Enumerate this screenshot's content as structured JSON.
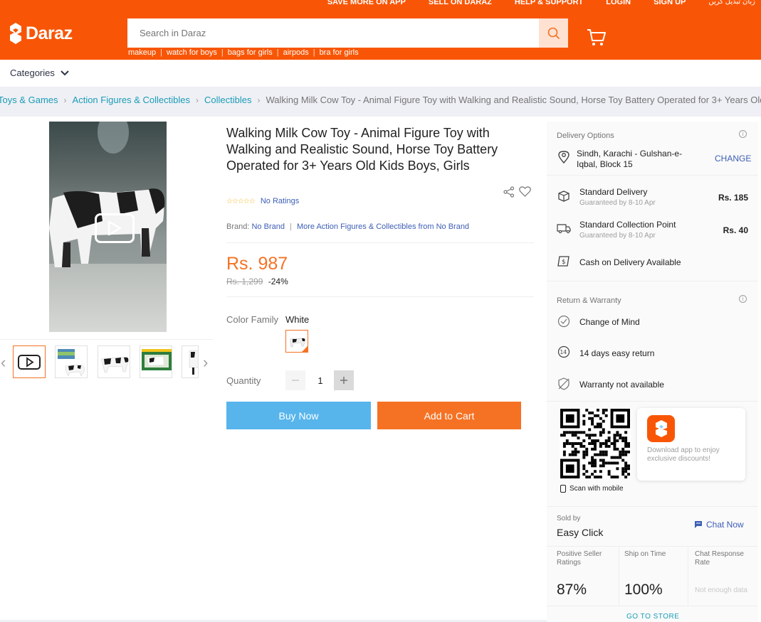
{
  "header": {
    "topnav": [
      "SAVE MORE ON APP",
      "SELL ON DARAZ",
      "HELP & SUPPORT",
      "LOGIN",
      "SIGN UP"
    ],
    "language": "زبان تبدیل کریں",
    "logo_text": "Daraz",
    "search_placeholder": "Search in Daraz",
    "suggestions": [
      "makeup",
      "watch for boys",
      "bags for girls",
      "airpods",
      "bra for girls"
    ]
  },
  "categories_label": "Categories",
  "breadcrumb": {
    "links": [
      "Toys & Games",
      "Action Figures & Collectibles",
      "Collectibles"
    ],
    "current": "Walking Milk Cow Toy - Animal Figure Toy with Walking and Realistic Sound, Horse Toy Battery Operated for 3+ Years Old"
  },
  "product": {
    "title": "Walking Milk Cow Toy - Animal Figure Toy with Walking and Realistic Sound, Horse Toy Battery Operated for 3+ Years Old Kids Boys, Girls",
    "rating_stars": "☆☆☆☆☆",
    "rating_text": "No Ratings",
    "brand_label": "Brand:",
    "brand": "No Brand",
    "brand_more": "More Action Figures & Collectibles from No Brand",
    "price": "Rs. 987",
    "old_price": "Rs. 1,299",
    "discount": "-24%",
    "color_label": "Color Family",
    "color_value": "White",
    "quantity_label": "Quantity",
    "quantity": "1",
    "buy_now": "Buy Now",
    "add_to_cart": "Add to Cart"
  },
  "delivery": {
    "heading": "Delivery Options",
    "address": "Sindh, Karachi - Gulshan-e-Iqbal, Block 15",
    "change": "CHANGE",
    "options": [
      {
        "name": "Standard Delivery",
        "sub": "Guaranteed by 8-10 Apr",
        "price": "Rs. 185"
      },
      {
        "name": "Standard Collection Point",
        "sub": "Guaranteed by 8-10 Apr",
        "price": "Rs. 40"
      }
    ],
    "cod": "Cash on Delivery Available"
  },
  "warranty": {
    "heading": "Return & Warranty",
    "items": [
      "Change of Mind",
      "14 days easy return",
      "Warranty not available"
    ]
  },
  "app_promo": {
    "scan": "Scan with mobile",
    "text": "Download app to enjoy exclusive discounts!"
  },
  "seller": {
    "sold_by": "Sold by",
    "name": "Easy Click",
    "chat": "Chat Now",
    "stats": [
      {
        "label": "Positive Seller Ratings",
        "value": "87%"
      },
      {
        "label": "Ship on Time",
        "value": "100%"
      },
      {
        "label": "Chat Response Rate",
        "value": "Not enough data"
      }
    ],
    "go_store": "GO TO STORE"
  },
  "colors": {
    "brand": "#f85606",
    "price": "#f57224",
    "buy_now": "#57b5ec",
    "link": "#3e5eb6",
    "breadcrumb_link": "#1a9cb7"
  }
}
